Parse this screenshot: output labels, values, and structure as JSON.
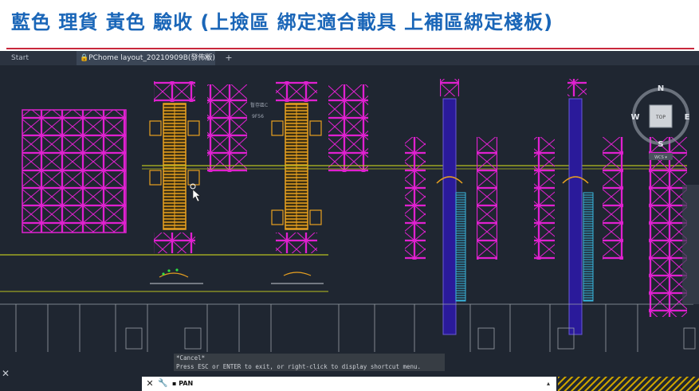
{
  "slide": {
    "title": "藍色  理貨  黃色 驗收 (上撿區 綁定適合載具 上補區綁定棧板)"
  },
  "tabs": [
    {
      "label": "Start"
    },
    {
      "label": "PChome layout_20210909B(發佈版)"
    }
  ],
  "tab_close_glyph": "✕",
  "tab_add_glyph": "+",
  "window_controls": {
    "minimize": "–",
    "restore": "▫",
    "close": "✕"
  },
  "viewcube": {
    "top": "TOP",
    "north": "N",
    "south": "S",
    "east": "E",
    "west": "W",
    "wcs": "WCS ▾"
  },
  "drawing_label": {
    "line1": "暫存區C",
    "line2": "9F56"
  },
  "command": {
    "history": [
      "*Cancel*",
      "Press ESC or ENTER to exit, or right-click to display shortcut menu."
    ],
    "prompt": "▪ PAN",
    "close_glyph": "✕",
    "wrench_glyph": "🔧",
    "caret": "▴"
  },
  "colors": {
    "title_blue": "#1a66b8",
    "rack_magenta": "#e020d0",
    "conveyor_yellow": "#e8a020",
    "aisle_blue": "#2a1a9a",
    "cyan": "#3ab8e0",
    "guide_line": "#b8c020"
  },
  "side_close": "✕"
}
